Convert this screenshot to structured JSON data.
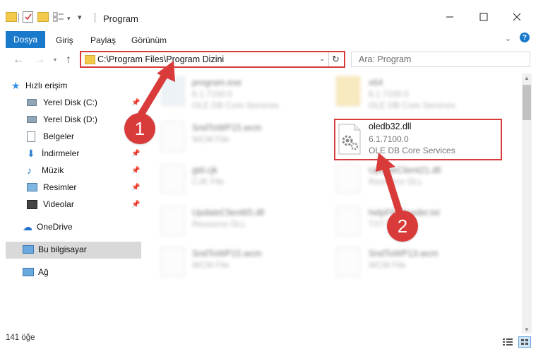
{
  "window": {
    "title": "Program",
    "minimize_icon": "minimize-icon",
    "maximize_icon": "maximize-icon",
    "close_icon": "close-icon"
  },
  "ribbon": {
    "tabs": [
      "Dosya",
      "Giriş",
      "Paylaş",
      "Görünüm"
    ]
  },
  "navbar": {
    "address": "C:\\Program Files\\Program Dizini",
    "search_placeholder": "Ara: Program"
  },
  "sidebar": {
    "quick_access": "Hızlı erişim",
    "items": [
      {
        "label": "Yerel Disk (C:)",
        "icon": "drive-icon",
        "pinned": true
      },
      {
        "label": "Yerel Disk (D:)",
        "icon": "drive-icon",
        "pinned": false
      },
      {
        "label": "Belgeler",
        "icon": "documents-icon",
        "pinned": true
      },
      {
        "label": "İndirmeler",
        "icon": "download-icon",
        "pinned": true
      },
      {
        "label": "Müzik",
        "icon": "music-icon",
        "pinned": true
      },
      {
        "label": "Resimler",
        "icon": "pictures-icon",
        "pinned": true
      },
      {
        "label": "Videolar",
        "icon": "videos-icon",
        "pinned": true
      }
    ],
    "onedrive": "OneDrive",
    "this_pc": "Bu bilgisayar",
    "network": "Ağ"
  },
  "files": {
    "highlighted": {
      "name": "oledb32.dll",
      "version": "6.1.7100.0",
      "desc": "OLE DB Core Services"
    },
    "others": [
      {
        "name": "program.exe",
        "sub1": "6.1.7100.0",
        "sub2": "OLE DB Core Services"
      },
      {
        "name": "x64",
        "sub1": "6.1.7100.0",
        "sub2": "OLE DB Core Services"
      },
      {
        "name": "SndToWP15.wcm",
        "sub1": "WCM File",
        "sub2": ""
      },
      {
        "name": "gtd.cjk",
        "sub1": "CJK File",
        "sub2": ""
      },
      {
        "name": "UpdateClient21.dll",
        "sub1": "Resource DLL",
        "sub2": ""
      },
      {
        "name": "UpdateClient65.dll",
        "sub1": "Resource DLL",
        "sub2": ""
      },
      {
        "name": "helpFileReader.txt",
        "sub1": "TXT File",
        "sub2": ""
      },
      {
        "name": "SndToWP15.wcm",
        "sub1": "WCM File",
        "sub2": ""
      },
      {
        "name": "SndToWP13.wcm",
        "sub1": "WCM File",
        "sub2": ""
      }
    ]
  },
  "markers": [
    "1",
    "2"
  ],
  "status": {
    "count": "141 öğe"
  },
  "colors": {
    "accent": "#1979ca",
    "highlight": "#d93a3a"
  }
}
